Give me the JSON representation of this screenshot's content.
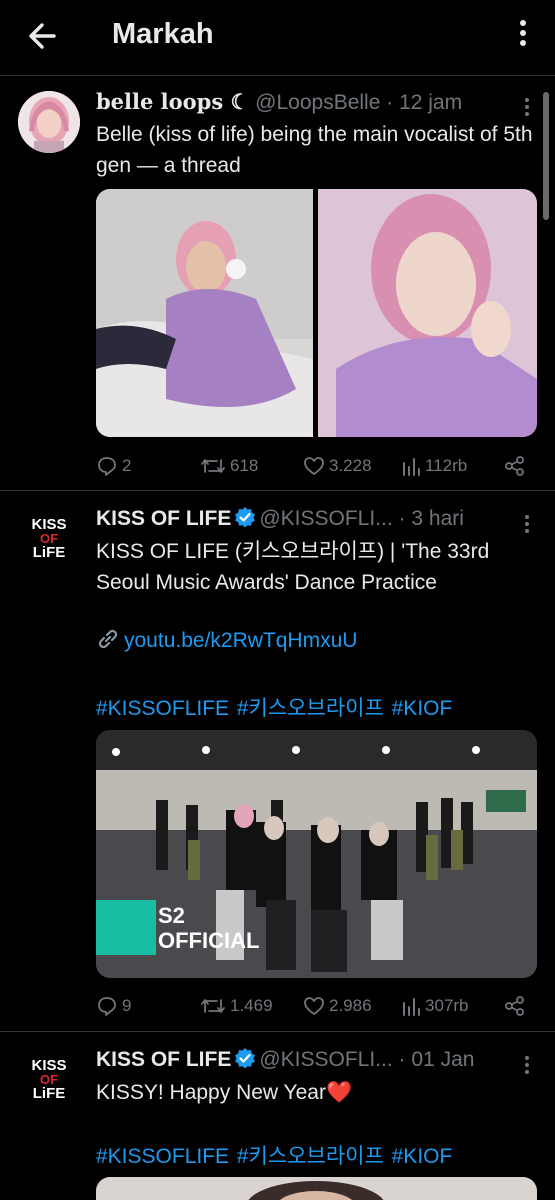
{
  "header": {
    "title": "Markah"
  },
  "tweets": [
    {
      "display_name": "belle loops ☾",
      "handle": "@LoopsBelle",
      "dot": "·",
      "time": "12 jam",
      "text": "Belle (kiss of life) being the main vocalist of 5th gen — a thread",
      "stats": {
        "replies": "2",
        "reposts": "618",
        "likes": "3.228",
        "views": "112rb"
      }
    },
    {
      "display_name": "KISS OF LIFE",
      "handle": "@KISSOFLI...",
      "dot": "·",
      "time": "3 hari",
      "logo": {
        "line1": "KISS",
        "line2": "OF",
        "line3": "LiFE"
      },
      "text": "KISS OF LIFE (키스오브라이프) | 'The 33rd Seoul Music Awards' Dance Practice",
      "link": "youtu.be/k2RwTqHmxuU",
      "hashtags": "#KISSOFLIFE #키스오브라이프 #KIOF",
      "media_badge": {
        "line1": "S2",
        "line2": "OFFICIAL"
      },
      "stats": {
        "replies": "9",
        "reposts": "1.469",
        "likes": "2.986",
        "views": "307rb"
      }
    },
    {
      "display_name": "KISS OF LIFE",
      "handle": "@KISSOFLI...",
      "dot": "·",
      "time": "01 Jan",
      "logo": {
        "line1": "KISS",
        "line2": "OF",
        "line3": "LiFE"
      },
      "text": "KISSY! Happy New Year❤️",
      "hashtags": "#KISSOFLIFE #키스오브라이프 #KIOF"
    }
  ],
  "colors": {
    "accent": "#1d9bf0",
    "muted": "#71767b",
    "text": "#e7e9ea",
    "background": "#000000",
    "verified": "#1d9bf0"
  },
  "icons": [
    "back-arrow-icon",
    "more-vertical-icon",
    "reply-icon",
    "repost-icon",
    "like-icon",
    "views-icon",
    "share-icon",
    "verified-badge-icon",
    "link-icon"
  ]
}
